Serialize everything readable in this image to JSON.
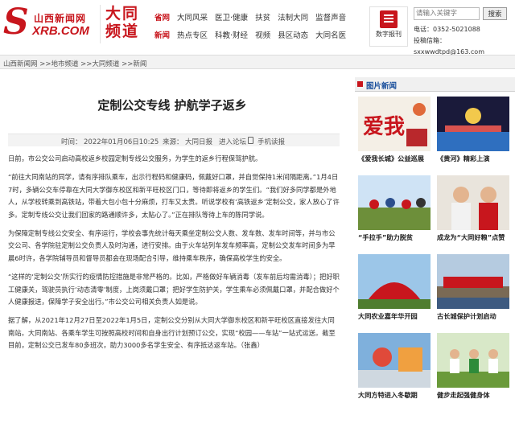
{
  "header": {
    "logo_cn": "山西新闻网",
    "logo_en": "XRB.COM",
    "channel_line1": "大同",
    "channel_line2": "频道",
    "nav_row1": [
      "省网",
      "大同风采",
      "医卫·健康",
      "扶贫",
      "法制大同",
      "监督声音"
    ],
    "nav_row2": [
      "新闻",
      "热点专区",
      "科教·财经",
      "视频",
      "县区动态",
      "大同名医"
    ],
    "epaper_label": "数字报刊",
    "search_placeholder": "请输入关键字",
    "search_button": "搜索",
    "phone": "电话：0352-5021088",
    "email": "投稿信箱：sxxwwdtpd@163.com"
  },
  "breadcrumb": "山西新闻网 >>地市频道 >>大同频道 >>新闻",
  "article": {
    "title": "定制公交专线 护航学子返乡",
    "time_label": "时间：",
    "time": "2022年01月06日10:25",
    "source_label": "来源：",
    "source": "大同日报",
    "forum_link": "进入论坛",
    "mobile_link": "手机读报",
    "paragraphs": [
      "日前，市公交公司启动高校返乡校园定制专线公交服务，为学生的返乡行程保驾护航。",
      "“前往大同南站的同学，请有序排队乘车，出示行程码和健康码，佩戴好口罩，并自觉保持1米间隔距离。”1月4日7时，多辆公交车停靠在大同大学御东校区和新平旺校区门口，等待即将返乡的学生们。“我们好多同学都是外地人，从学校转乘到高铁站，带着大包小包十分麻烦，打车又太贵。听说学校有‘高铁返乡’定制公交，家人放心了许多。定制专线公交让我们回家的路通顺许多，太贴心了。”正在排队等待上车的陈同学说。",
      "为保障定制专线公交安全、有序运行，学校会事先统计每天乘坐定制公交人数、发车数、发车时间等，并与市公交公司、各学院驻定制公交负责人及时沟通，进行安排。由于火车站列车发车频率高，定制公交发车时间多为早晨6时许，各学院辅导员和督导员都会在现场配合引导，维持乘车秩序，确保高校学生的安全。",
      "“这样的‘定制公交’所实行的疫情防控措施是非常严格的。比如，严格做好车辆消毒（发车前后均需消毒）；把好职工健康关，驾驶员执行‘动态清零’制度，上岗须戴口罩；把好学生防护关，学生乘车必须佩戴口罩，并配合做好个人健康报送，保障学子安全出行。”市公交公司相关负责人如是说。",
      "据了解，从2021年12月27日至2022年1月5日，定制公交分别从大同大学御东校区和新平旺校区直接发往大同南站。大同南站、各乘车学生可按照高校时间和自身出行计划预订公交，实现“校园——车站”一站式运送。截至目前，定制公交已发车80多班次，助力3000多名学生安全、有序抵达返车站。（张鑫）"
    ]
  },
  "sidebar": {
    "title": "图片新闻",
    "items": [
      {
        "caption": "《爱我长城》公益巡展"
      },
      {
        "caption": "《黄河》精彩上演"
      },
      {
        "caption": "“手拉手”助力脱贫"
      },
      {
        "caption": "成龙为“大同好粮”点赞"
      },
      {
        "caption": "大同农业嘉年华开园"
      },
      {
        "caption": "古长城保护计划启动"
      },
      {
        "caption": "大同方特进入冬歇期"
      },
      {
        "caption": "健步走起强健身体"
      }
    ]
  }
}
